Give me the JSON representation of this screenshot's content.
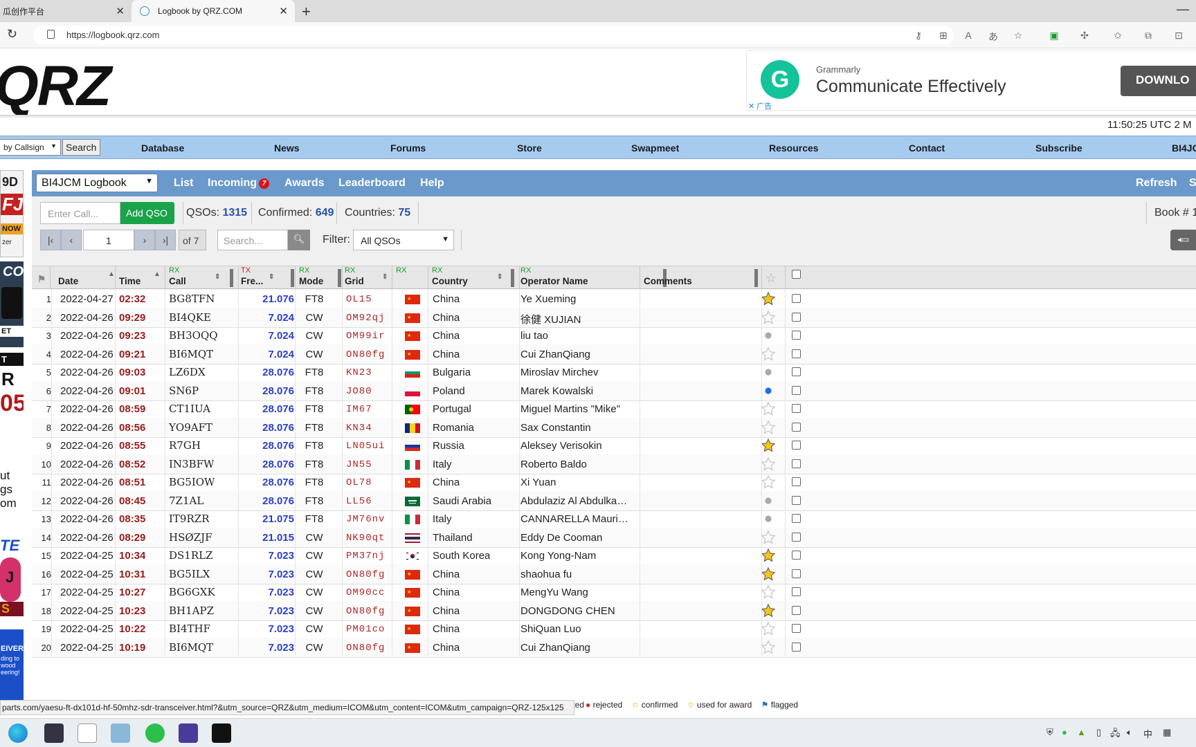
{
  "browser": {
    "tabs": [
      {
        "label": "瓜创作平台",
        "active": false
      },
      {
        "label": "Logbook by QRZ.COM",
        "active": true
      }
    ],
    "url": "https://logbook.qrz.com"
  },
  "header": {
    "logo": "QRZ",
    "ad": {
      "brand": "Grammarly",
      "headline": "Communicate Effectively",
      "button": "DOWNLO",
      "mark": "✕ 广告"
    },
    "utc_time": "11:50:25 UTC 2 M"
  },
  "nav": {
    "search_by": "by Callsign",
    "search_button": "Search",
    "items": [
      "Database",
      "News",
      "Forums",
      "Store",
      "Swapmeet",
      "Resources",
      "Contact",
      "Subscribe",
      "BI4JC"
    ]
  },
  "left_ads": {
    "snippets": [
      "9D",
      "FJ",
      "NOW",
      "zer",
      "CO",
      "ET",
      "T",
      "R",
      "05",
      "ut",
      "gs",
      "om",
      "TE",
      "J",
      "S",
      "EIVER",
      "ding to",
      "wood",
      "eering!"
    ]
  },
  "logbook": {
    "book_select": "BI4JCM Logbook",
    "nav": {
      "list": "List",
      "incoming": "Incoming",
      "incoming_count": "7",
      "awards": "Awards",
      "leaderboard": "Leaderboard",
      "help": "Help",
      "refresh": "Refresh",
      "s": "S"
    },
    "call_placeholder": "Enter Call...",
    "add_qso": "Add QSO",
    "qsos_label": "QSOs:",
    "qsos": "1315",
    "confirmed_label": "Confirmed:",
    "confirmed": "649",
    "countries_label": "Countries:",
    "countries": "75",
    "book_num": "Book # 1",
    "page": "1",
    "of_pages": "of 7",
    "search_placeholder": "Search...",
    "filter_label": "Filter:",
    "filter_value": "All QSOs"
  },
  "table": {
    "headers": {
      "date": "Date",
      "time": "Time",
      "call": "Call",
      "call_tag": "RX",
      "freq": "Fre...",
      "freq_tag": "TX",
      "mode": "Mode",
      "mode_tag": "RX",
      "grid": "Grid",
      "grid_tag": "RX",
      "flag_tag": "RX",
      "country": "Country",
      "country_tag": "RX",
      "op": "Operator Name",
      "op_tag": "RX",
      "comments": "Comments"
    },
    "rows": [
      {
        "n": "1",
        "date": "2022-04-27",
        "time": "02:32",
        "call": "BG8TFN",
        "freq": "21.076",
        "mode": "FT8",
        "grid": "OL15",
        "flag": "cn",
        "country": "China",
        "op": "Ye Xueming",
        "status": "confirmed"
      },
      {
        "n": "2",
        "date": "2022-04-26",
        "time": "09:29",
        "call": "BI4QKE",
        "freq": "7.024",
        "mode": "CW",
        "grid": "OM92qj",
        "flag": "cn",
        "country": "China",
        "op": "徐健 XUJIAN",
        "status": "none"
      },
      {
        "n": "3",
        "date": "2022-04-26",
        "time": "09:23",
        "call": "BH3OQQ",
        "freq": "7.024",
        "mode": "CW",
        "grid": "OM99ir",
        "flag": "cn",
        "country": "China",
        "op": "liu tao",
        "status": "requested"
      },
      {
        "n": "4",
        "date": "2022-04-26",
        "time": "09:21",
        "call": "BI6MQT",
        "freq": "7.024",
        "mode": "CW",
        "grid": "ON80fg",
        "flag": "cn",
        "country": "China",
        "op": "Cui ZhanQiang",
        "status": "none"
      },
      {
        "n": "5",
        "date": "2022-04-26",
        "time": "09:03",
        "call": "LZ6DX",
        "freq": "28.076",
        "mode": "FT8",
        "grid": "KN23",
        "flag": "bg",
        "country": "Bulgaria",
        "op": "Miroslav Mirchev",
        "status": "requested"
      },
      {
        "n": "6",
        "date": "2022-04-26",
        "time": "09:01",
        "call": "SN6P",
        "freq": "28.076",
        "mode": "FT8",
        "grid": "JO80",
        "flag": "pl",
        "country": "Poland",
        "op": "Marek Kowalski",
        "status": "request-open"
      },
      {
        "n": "7",
        "date": "2022-04-26",
        "time": "08:59",
        "call": "CT1IUA",
        "freq": "28.076",
        "mode": "FT8",
        "grid": "IM67",
        "flag": "pt",
        "country": "Portugal",
        "op": "Miguel Martins \"Mike\"",
        "status": "none"
      },
      {
        "n": "8",
        "date": "2022-04-26",
        "time": "08:56",
        "call": "YO9AFT",
        "freq": "28.076",
        "mode": "FT8",
        "grid": "KN34",
        "flag": "ro",
        "country": "Romania",
        "op": "Sax Constantin",
        "status": "none"
      },
      {
        "n": "9",
        "date": "2022-04-26",
        "time": "08:55",
        "call": "R7GH",
        "freq": "28.076",
        "mode": "FT8",
        "grid": "LN05ui",
        "flag": "ru",
        "country": "Russia",
        "op": "Aleksey Verisokin",
        "status": "confirmed"
      },
      {
        "n": "10",
        "date": "2022-04-26",
        "time": "08:52",
        "call": "IN3BFW",
        "freq": "28.076",
        "mode": "FT8",
        "grid": "JN55",
        "flag": "it",
        "country": "Italy",
        "op": "Roberto Baldo",
        "status": "none"
      },
      {
        "n": "11",
        "date": "2022-04-26",
        "time": "08:51",
        "call": "BG5IOW",
        "freq": "28.076",
        "mode": "FT8",
        "grid": "OL78",
        "flag": "cn",
        "country": "China",
        "op": "Xi Yuan",
        "status": "none"
      },
      {
        "n": "12",
        "date": "2022-04-26",
        "time": "08:45",
        "call": "7Z1AL",
        "freq": "28.076",
        "mode": "FT8",
        "grid": "LL56",
        "flag": "sa",
        "country": "Saudi Arabia",
        "op": "Abdulaziz Al Abdulka…",
        "status": "requested"
      },
      {
        "n": "13",
        "date": "2022-04-26",
        "time": "08:35",
        "call": "IT9RZR",
        "freq": "21.075",
        "mode": "FT8",
        "grid": "JM76nv",
        "flag": "it",
        "country": "Italy",
        "op": "CANNARELLA Mauri…",
        "status": "requested"
      },
      {
        "n": "14",
        "date": "2022-04-26",
        "time": "08:29",
        "call": "HSØZJF",
        "freq": "21.015",
        "mode": "CW",
        "grid": "NK90qt",
        "flag": "th",
        "country": "Thailand",
        "op": "Eddy De Cooman",
        "status": "none"
      },
      {
        "n": "15",
        "date": "2022-04-25",
        "time": "10:34",
        "call": "DS1RLZ",
        "freq": "7.023",
        "mode": "CW",
        "grid": "PM37nj",
        "flag": "kr",
        "country": "South Korea",
        "op": "Kong Yong-Nam",
        "status": "confirmed"
      },
      {
        "n": "16",
        "date": "2022-04-25",
        "time": "10:31",
        "call": "BG5ILX",
        "freq": "7.023",
        "mode": "CW",
        "grid": "ON80fg",
        "flag": "cn",
        "country": "China",
        "op": "shaohua fu",
        "status": "confirmed"
      },
      {
        "n": "17",
        "date": "2022-04-25",
        "time": "10:27",
        "call": "BG6GXK",
        "freq": "7.023",
        "mode": "CW",
        "grid": "OM90cc",
        "flag": "cn",
        "country": "China",
        "op": "MengYu Wang",
        "status": "none"
      },
      {
        "n": "18",
        "date": "2022-04-25",
        "time": "10:23",
        "call": "BH1APZ",
        "freq": "7.023",
        "mode": "CW",
        "grid": "ON80fg",
        "flag": "cn",
        "country": "China",
        "op": "DONGDONG CHEN",
        "status": "confirmed"
      },
      {
        "n": "19",
        "date": "2022-04-25",
        "time": "10:22",
        "call": "BI4THF",
        "freq": "7.023",
        "mode": "CW",
        "grid": "PM01co",
        "flag": "cn",
        "country": "China",
        "op": "ShiQuan Luo",
        "status": "none"
      },
      {
        "n": "20",
        "date": "2022-04-25",
        "time": "10:19",
        "call": "BI6MQT",
        "freq": "7.023",
        "mode": "CW",
        "grid": "ON80fg",
        "flag": "cn",
        "country": "China",
        "op": "Cui ZhanQiang",
        "status": "none"
      }
    ]
  },
  "legend": {
    "requested": "requested",
    "rejected": "rejected",
    "confirmed": "confirmed",
    "award": "used for award",
    "flagged": "flagged"
  },
  "status_url": "parts.com/yaesu-ft-dx101d-hf-50mhz-sdr-transceiver.html?&utm_source=QRZ&utm_medium=ICOM&utm_content=ICOM&utm_campaign=QRZ-125x125",
  "tray": {
    "ime": "中"
  },
  "colors": {
    "accent": "#6a99cc",
    "nav": "#a6cbef",
    "add_button": "#1ba34b",
    "freq": "#2b3fc8",
    "time": "#9b1b1b",
    "grid": "#b02828",
    "star": "#f5c518"
  }
}
